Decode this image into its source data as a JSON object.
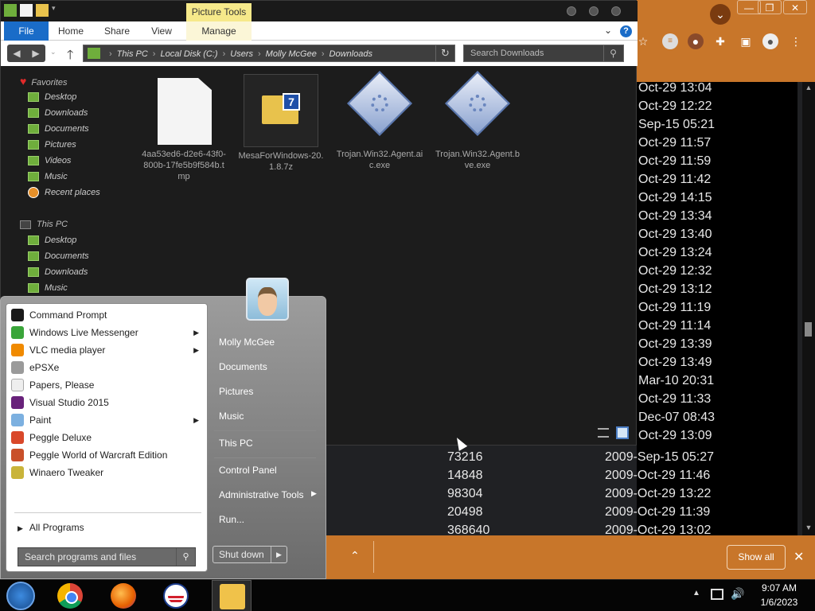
{
  "browser": {
    "download_times": [
      "Oct-29 13:04",
      "Oct-29 12:22",
      "Sep-15 05:21",
      "Oct-29 11:57",
      "Oct-29 11:59",
      "Oct-29 11:42",
      "Oct-29 14:15",
      "Oct-29 13:34",
      "Oct-29 13:40",
      "Oct-29 13:24",
      "Oct-29 12:32",
      "Oct-29 13:12",
      "Oct-29 11:19",
      "Oct-29 11:14",
      "Oct-29 13:39",
      "Oct-29 13:49",
      "Mar-10 20:31",
      "Oct-29 11:33",
      "Dec-07 08:43",
      "Oct-29 13:09"
    ],
    "download_rows": [
      {
        "size": "73216",
        "date": "2009-Sep-15 05:27"
      },
      {
        "size": "14848",
        "date": "2009-Oct-29 11:46"
      },
      {
        "size": "98304",
        "date": "2009-Oct-29 13:22"
      },
      {
        "size": "20498",
        "date": "2009-Oct-29 11:39"
      },
      {
        "size": "368640",
        "date": "2009-Oct-29 13:02"
      }
    ],
    "show_all_label": "Show all"
  },
  "explorer": {
    "contextual_tab": "Picture Tools",
    "tabs": {
      "file": "File",
      "home": "Home",
      "share": "Share",
      "view": "View",
      "manage": "Manage"
    },
    "breadcrumbs": [
      "This PC",
      "Local Disk (C:)",
      "Users",
      "Molly McGee",
      "Downloads"
    ],
    "search_placeholder": "Search Downloads",
    "nav": {
      "favorites": "Favorites",
      "fav_items": [
        "Desktop",
        "Downloads",
        "Documents",
        "Pictures",
        "Videos",
        "Music",
        "Recent places"
      ],
      "this_pc": "This PC",
      "pc_items": [
        "Desktop",
        "Documents",
        "Downloads",
        "Music"
      ]
    },
    "files": [
      {
        "name": "4aa53ed6-d2e6-43f0-800b-17fe5b9f584b.tmp",
        "kind": "tmp"
      },
      {
        "name": "MesaForWindows-20.1.8.7z",
        "kind": "7z"
      },
      {
        "name": "Trojan.Win32.Agent.aic.exe",
        "kind": "exe"
      },
      {
        "name": "Trojan.Win32.Agent.bve.exe",
        "kind": "exe"
      }
    ]
  },
  "start_menu": {
    "apps": [
      {
        "label": "Command Prompt",
        "color": "#1a1a1a",
        "submenu": false
      },
      {
        "label": "Windows Live Messenger",
        "color": "#3aa53a",
        "submenu": true
      },
      {
        "label": "VLC media player",
        "color": "#f08a00",
        "submenu": true
      },
      {
        "label": "ePSXe",
        "color": "#9a9a9a",
        "submenu": false
      },
      {
        "label": "Papers, Please",
        "color": "#eeeeee",
        "submenu": false
      },
      {
        "label": "Visual Studio 2015",
        "color": "#68217a",
        "submenu": false
      },
      {
        "label": "Paint",
        "color": "#7cb0e0",
        "submenu": true
      },
      {
        "label": "Peggle Deluxe",
        "color": "#d9482a",
        "submenu": false
      },
      {
        "label": "Peggle World of Warcraft Edition",
        "color": "#c9502a",
        "submenu": false
      },
      {
        "label": "Winaero Tweaker",
        "color": "#c9b43a",
        "submenu": false
      }
    ],
    "all_programs": "All Programs",
    "search_placeholder": "Search programs and files",
    "right": {
      "user": "Molly McGee",
      "documents": "Documents",
      "pictures": "Pictures",
      "music": "Music",
      "this_pc": "This PC",
      "control_panel": "Control Panel",
      "admin_tools": "Administrative Tools",
      "run": "Run..."
    },
    "shutdown_label": "Shut down"
  },
  "taskbar": {
    "time": "9:07 AM",
    "date": "1/6/2023"
  }
}
